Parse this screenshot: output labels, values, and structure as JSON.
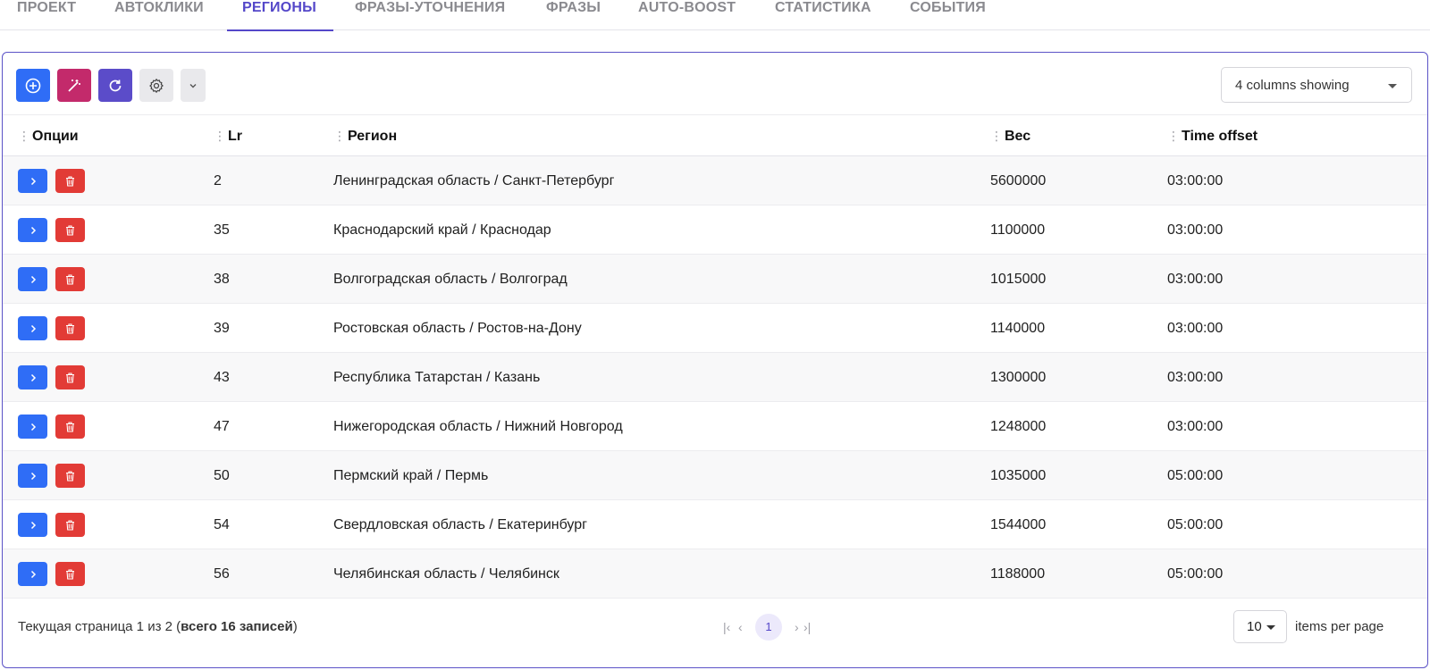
{
  "tabs": [
    {
      "label": "ПРОЕКТ",
      "active": false
    },
    {
      "label": "АВТОКЛИКИ",
      "active": false
    },
    {
      "label": "РЕГИОНЫ",
      "active": true
    },
    {
      "label": "ФРАЗЫ-УТОЧНЕНИЯ",
      "active": false
    },
    {
      "label": "ФРАЗЫ",
      "active": false
    },
    {
      "label": "AUTO-BOOST",
      "active": false
    },
    {
      "label": "СТАТИСТИКА",
      "active": false
    },
    {
      "label": "СОБЫТИЯ",
      "active": false
    }
  ],
  "toolbar": {
    "buttons": [
      {
        "icon": "add-circle-icon",
        "color": "#2f6df6"
      },
      {
        "icon": "magic-wand-icon",
        "color": "#c32a6b"
      },
      {
        "icon": "refresh-icon",
        "color": "#5b4cc9"
      },
      {
        "icon": "gear-icon",
        "color": "#e9e9ec"
      },
      {
        "icon": "chevron-down-icon",
        "color": "#e9e9ec"
      }
    ],
    "columns_select": "4 columns showing"
  },
  "table": {
    "columns": [
      "Опции",
      "Lr",
      "Регион",
      "Вес",
      "Time offset"
    ],
    "rows": [
      {
        "lr": "2",
        "region": "Ленинградская область / Санкт-Петербург",
        "weight": "5600000",
        "offset": "03:00:00"
      },
      {
        "lr": "35",
        "region": "Краснодарский край / Краснодар",
        "weight": "1100000",
        "offset": "03:00:00"
      },
      {
        "lr": "38",
        "region": "Волгоградская область / Волгоград",
        "weight": "1015000",
        "offset": "03:00:00"
      },
      {
        "lr": "39",
        "region": "Ростовская область / Ростов-на-Дону",
        "weight": "1140000",
        "offset": "03:00:00"
      },
      {
        "lr": "43",
        "region": "Республика Татарстан / Казань",
        "weight": "1300000",
        "offset": "03:00:00"
      },
      {
        "lr": "47",
        "region": "Нижегородская область / Нижний Новгород",
        "weight": "1248000",
        "offset": "03:00:00"
      },
      {
        "lr": "50",
        "region": "Пермский край / Пермь",
        "weight": "1035000",
        "offset": "05:00:00"
      },
      {
        "lr": "54",
        "region": "Свердловская область / Екатеринбург",
        "weight": "1544000",
        "offset": "05:00:00"
      },
      {
        "lr": "56",
        "region": "Челябинская область / Челябинск",
        "weight": "1188000",
        "offset": "05:00:00"
      }
    ]
  },
  "footer": {
    "status_prefix": "Текущая страница 1 из 2 (",
    "status_bold": "всего 16 записей",
    "status_suffix": ")",
    "pager_first": "|‹",
    "pager_prev": "‹",
    "current_page": "1",
    "pager_next": "›",
    "pager_last": "›|",
    "items_per_page_value": "10",
    "items_per_page_label": "items per page"
  },
  "colors": {
    "accent": "#5447c9",
    "open_button": "#2f6df6",
    "delete_button": "#e23b36"
  }
}
